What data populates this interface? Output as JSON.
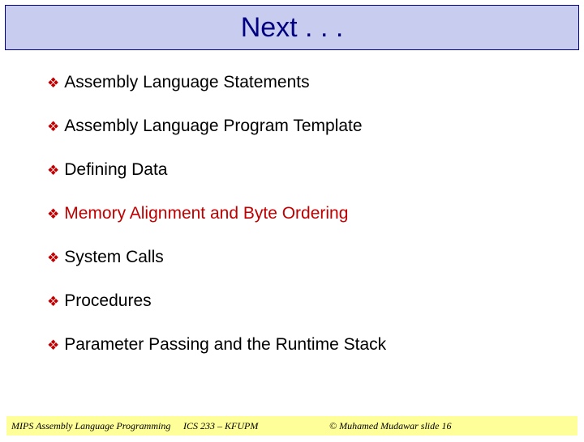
{
  "title": "Next . . .",
  "bullets": [
    {
      "text": "Assembly Language Statements",
      "highlight": false
    },
    {
      "text": "Assembly Language Program Template",
      "highlight": false
    },
    {
      "text": "Defining Data",
      "highlight": false
    },
    {
      "text": "Memory Alignment and Byte Ordering",
      "highlight": true
    },
    {
      "text": "System Calls",
      "highlight": false
    },
    {
      "text": "Procedures",
      "highlight": false
    },
    {
      "text": "Parameter Passing and the Runtime Stack",
      "highlight": false
    }
  ],
  "footer": {
    "left": "MIPS Assembly Language Programming",
    "middle": "ICS 233 – KFUPM",
    "right": "© Muhamed Mudawar   slide 16"
  }
}
